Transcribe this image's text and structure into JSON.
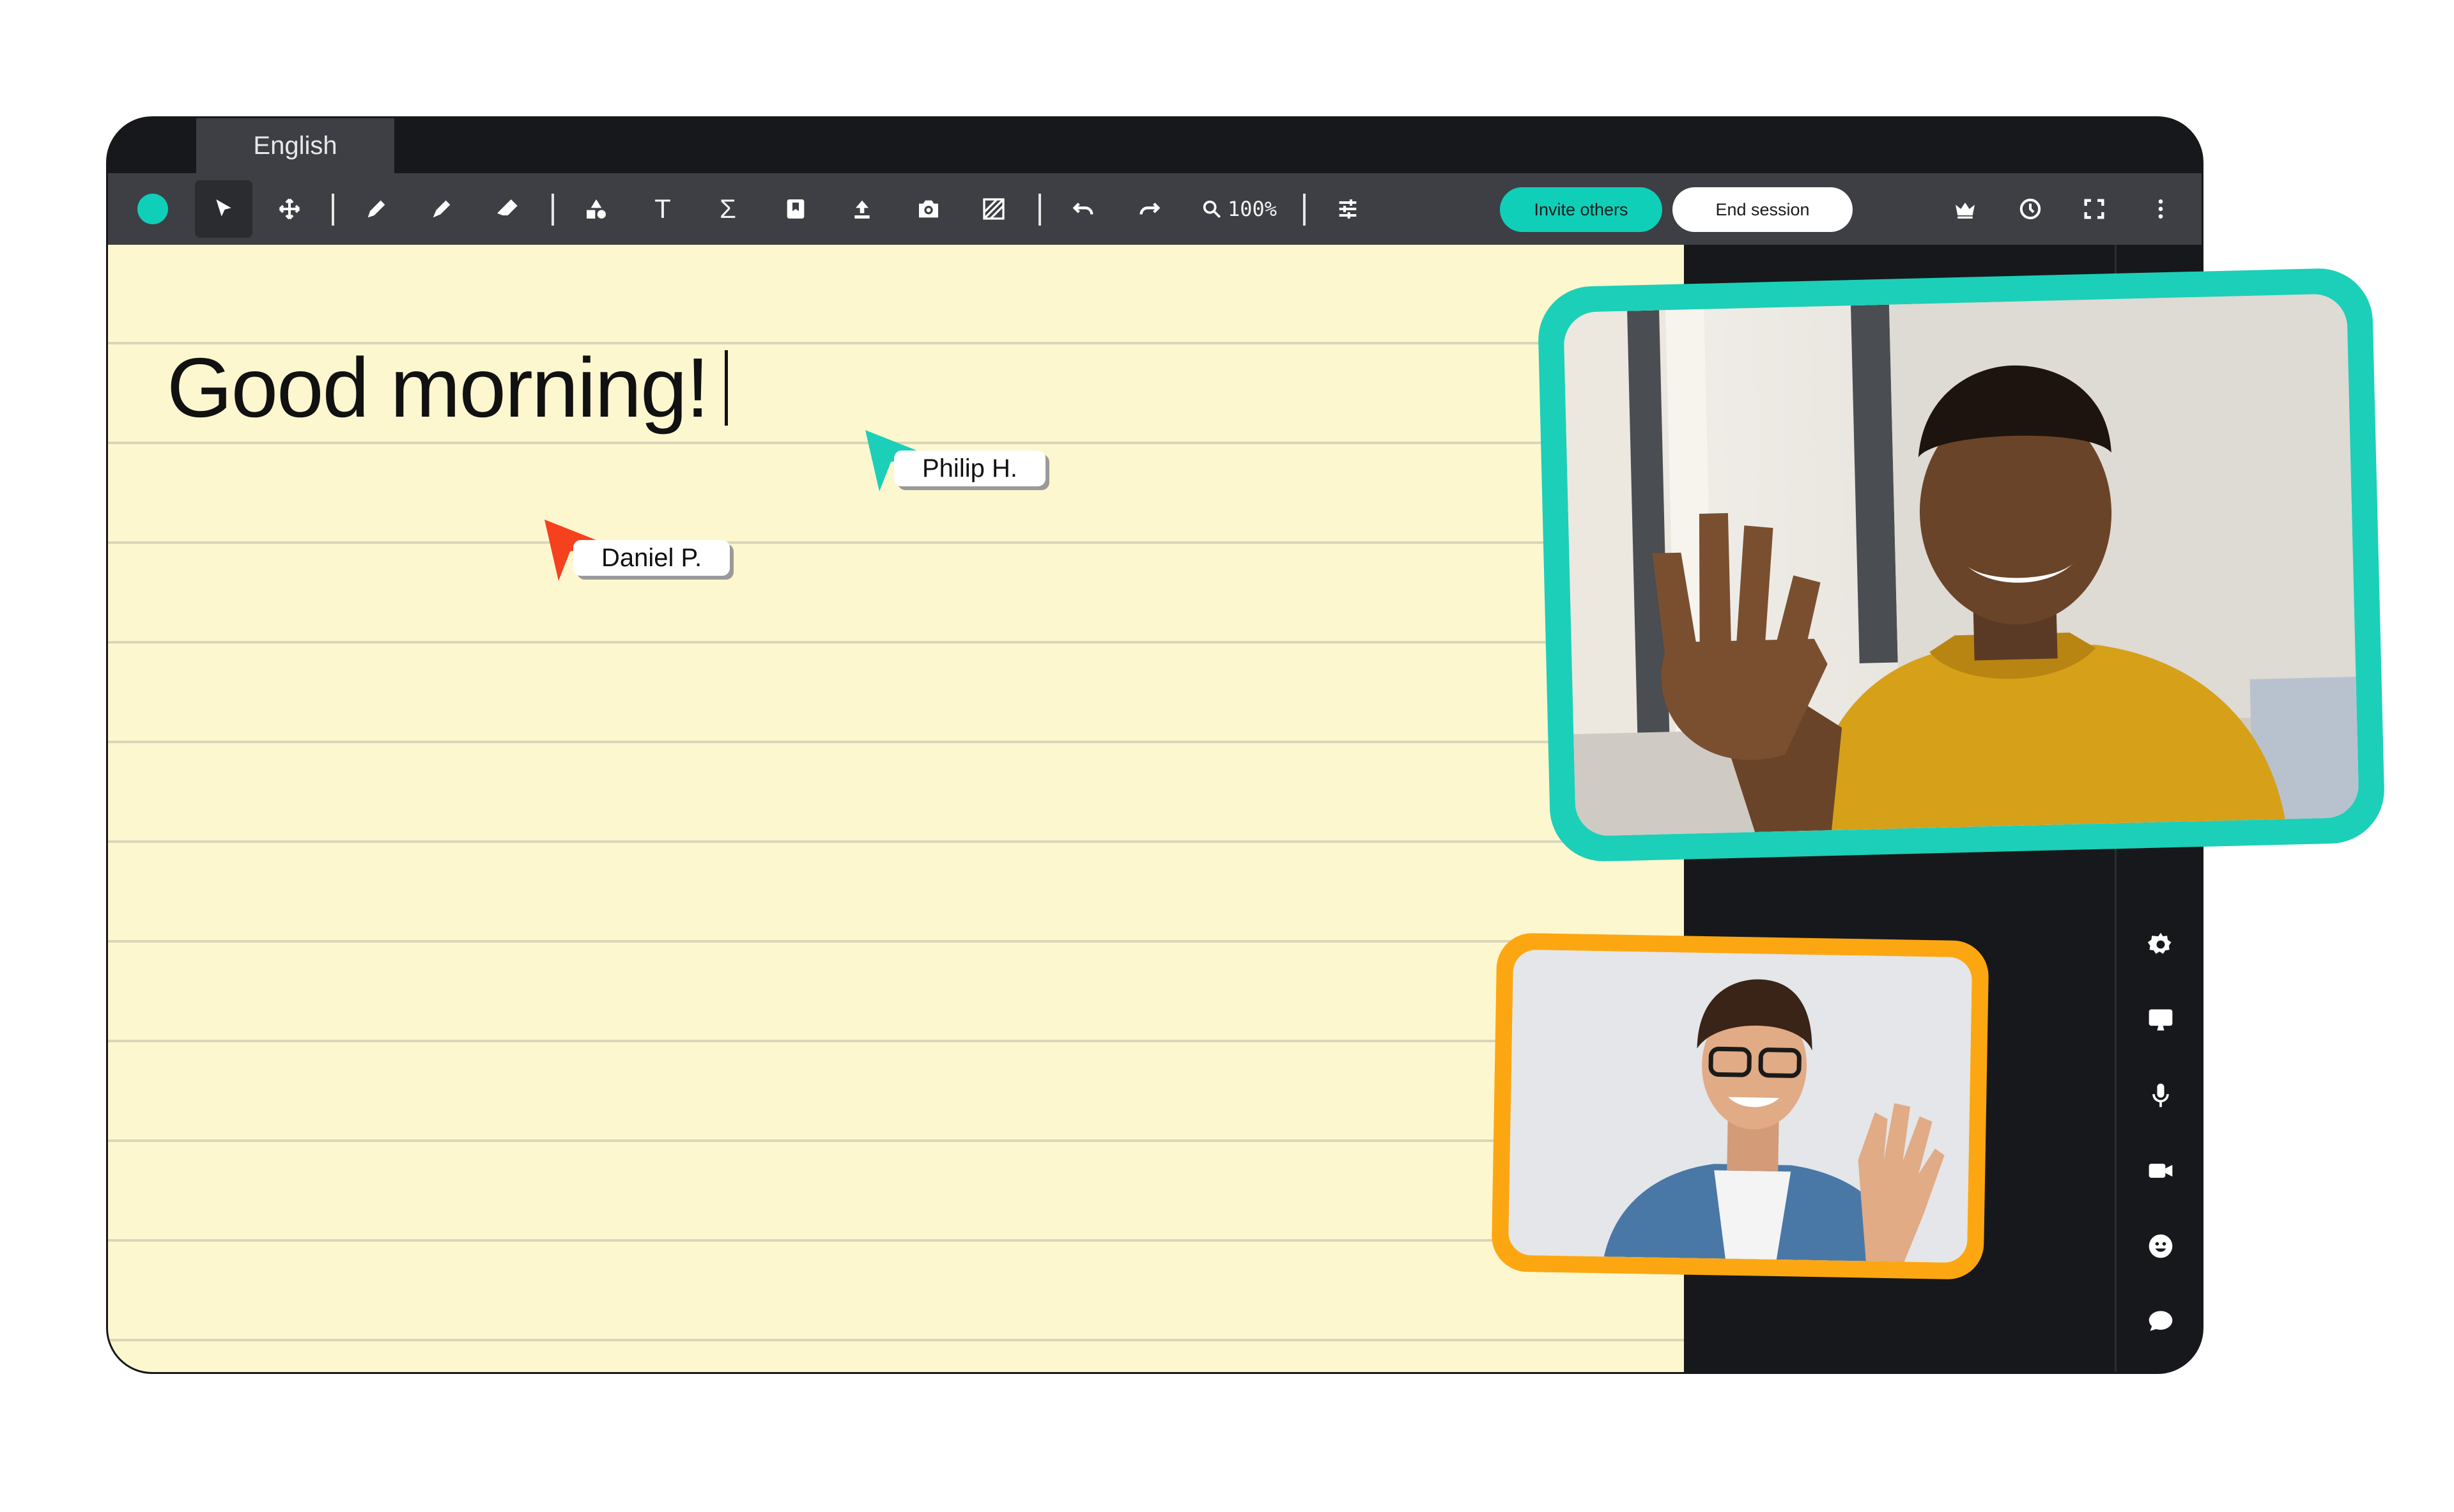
{
  "window": {
    "tab_label": "English"
  },
  "toolbar": {
    "color_dot": "#0fcfb8",
    "tools": [
      {
        "name": "select-tool",
        "icon": "arrow-pointer-icon"
      },
      {
        "name": "move-tool",
        "icon": "move-arrows-icon"
      },
      {
        "name": "pen-tool",
        "icon": "pen-icon"
      },
      {
        "name": "marker-tool",
        "icon": "marker-icon"
      },
      {
        "name": "eraser-tool",
        "icon": "eraser-icon"
      },
      {
        "name": "shapes-tool",
        "icon": "shapes-icon"
      },
      {
        "name": "text-tool",
        "icon": "text-t-icon"
      },
      {
        "name": "math-tool",
        "icon": "sigma-icon"
      },
      {
        "name": "bookmark-tool",
        "icon": "bookmark-icon"
      },
      {
        "name": "upload-tool",
        "icon": "upload-icon"
      },
      {
        "name": "camera-tool",
        "icon": "camera-icon"
      },
      {
        "name": "background-tool",
        "icon": "hatch-icon"
      },
      {
        "name": "undo-tool",
        "icon": "undo-icon"
      },
      {
        "name": "redo-tool",
        "icon": "redo-icon"
      },
      {
        "name": "settings-sliders-tool",
        "icon": "sliders-icon"
      }
    ],
    "text_tool_glyph": "T",
    "math_tool_glyph": "Σ",
    "zoom_level": "100%",
    "invite_label": "Invite others",
    "end_session_label": "End session",
    "accent": "#0fcfb8"
  },
  "canvas": {
    "heading": "Good morning!",
    "paper_color": "#fdf7cf"
  },
  "cursors": [
    {
      "name": "Philip H.",
      "color": "#1ccfb8"
    },
    {
      "name": "Daniel P.",
      "color": "#f5411d"
    }
  ],
  "sidebar": {
    "icons": [
      "gear-icon",
      "screen-share-icon",
      "microphone-icon",
      "video-camera-icon",
      "emoji-icon",
      "chat-icon"
    ]
  },
  "video": {
    "frames": [
      {
        "participant": "large",
        "border_color": "#1ccfb8"
      },
      {
        "participant": "small",
        "border_color": "#fca711"
      }
    ]
  }
}
